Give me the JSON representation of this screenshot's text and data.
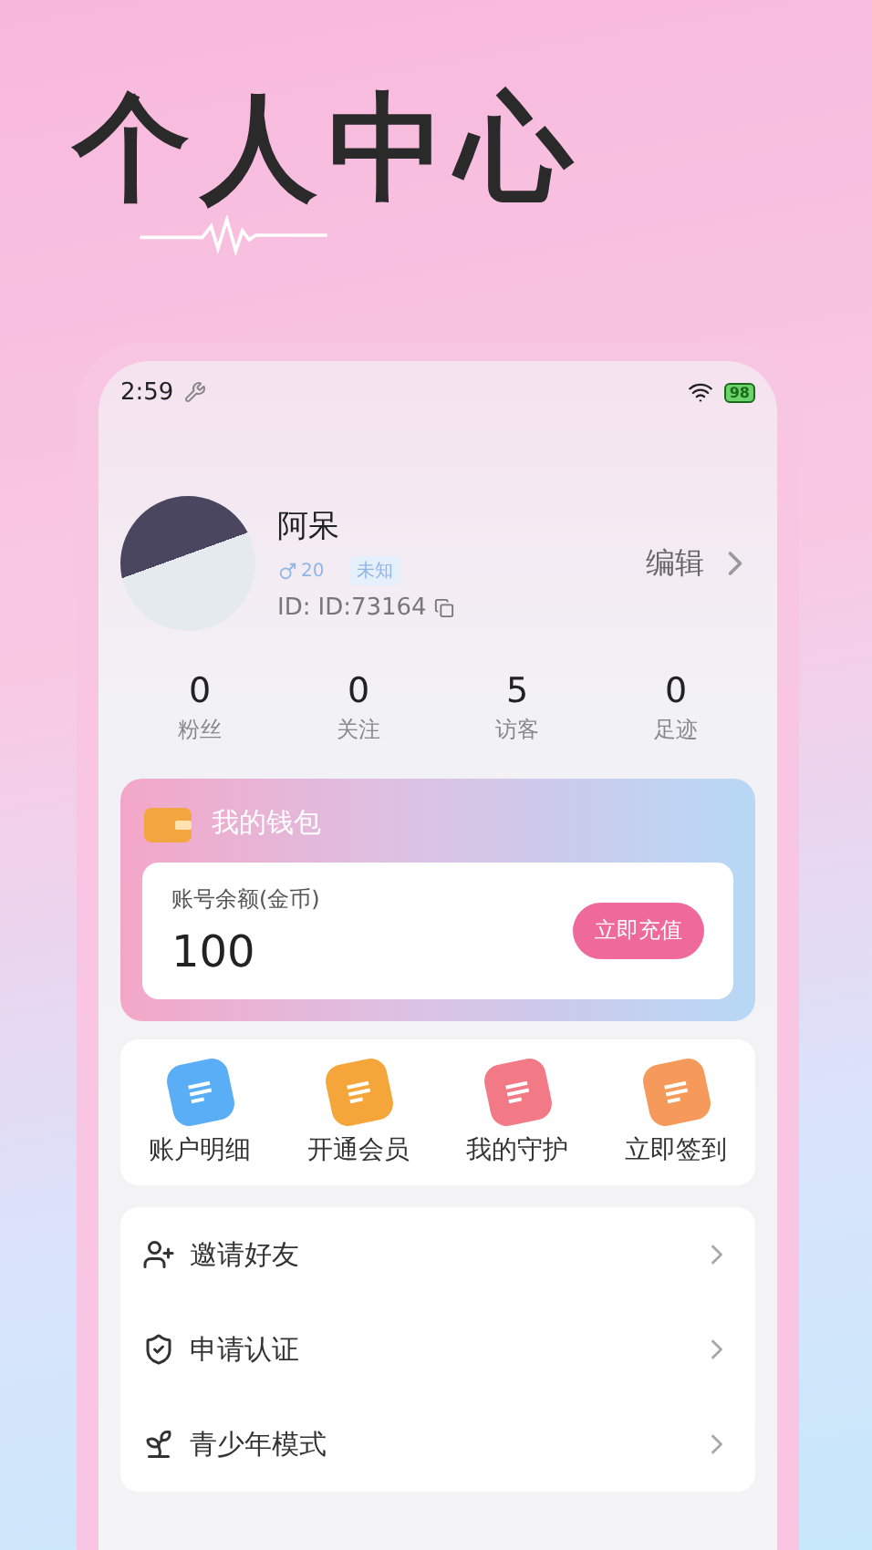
{
  "headline": "个人中心",
  "status_bar": {
    "time": "2:59",
    "battery": "98"
  },
  "profile": {
    "name": "阿呆",
    "age": "20",
    "gender_tag": "未知",
    "id_label": "ID:",
    "id_value": "ID:73164",
    "edit": "编辑"
  },
  "stats": [
    {
      "value": "0",
      "label": "粉丝"
    },
    {
      "value": "0",
      "label": "关注"
    },
    {
      "value": "5",
      "label": "访客"
    },
    {
      "value": "0",
      "label": "足迹"
    }
  ],
  "wallet": {
    "title": "我的钱包",
    "balance_label": "账号余额(金币)",
    "balance": "100",
    "recharge": "立即充值"
  },
  "actions": [
    {
      "label": "账户明细",
      "color": "#5aaef5"
    },
    {
      "label": "开通会员",
      "color": "#f5a63a"
    },
    {
      "label": "我的守护",
      "color": "#f27a86"
    },
    {
      "label": "立即签到",
      "color": "#f59a5a"
    }
  ],
  "menu": [
    {
      "label": "邀请好友"
    },
    {
      "label": "申请认证"
    },
    {
      "label": "青少年模式"
    }
  ]
}
